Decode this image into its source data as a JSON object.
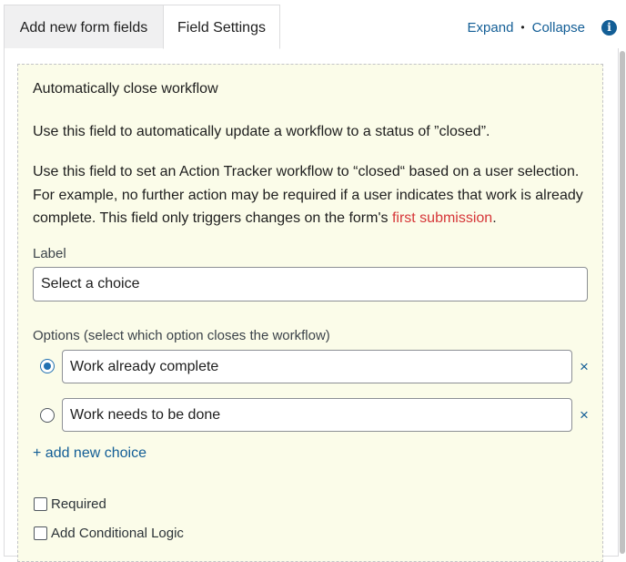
{
  "tabs": {
    "add_fields": "Add new form fields",
    "field_settings": "Field Settings"
  },
  "header_links": {
    "expand": "Expand",
    "separator": "•",
    "collapse": "Collapse",
    "info_icon": "i"
  },
  "field": {
    "title": "Automatically close workflow",
    "description": "Use this field to automatically update a workflow to a status of ”closed”.",
    "help_text": "Use this field to set an Action Tracker workflow to “closed“ based on a user selection. For example, no further action may be required if a user indicates that work is already complete. This field only triggers changes on the form's ",
    "help_link": "first submission",
    "help_end": "."
  },
  "label_section": {
    "label": "Label",
    "value": "Select a choice"
  },
  "options_section": {
    "label": "Options (select which option closes the workflow)",
    "choices": [
      {
        "value": "Work already complete",
        "selected": true
      },
      {
        "value": "Work needs to be done",
        "selected": false
      }
    ],
    "remove_glyph": "×",
    "add_choice": "+ add new choice"
  },
  "checkboxes": {
    "required": "Required",
    "conditional_logic": "Add Conditional Logic"
  },
  "colors": {
    "accent": "#135e96",
    "link_red": "#d63638",
    "panel_bg": "#fbfce9"
  }
}
